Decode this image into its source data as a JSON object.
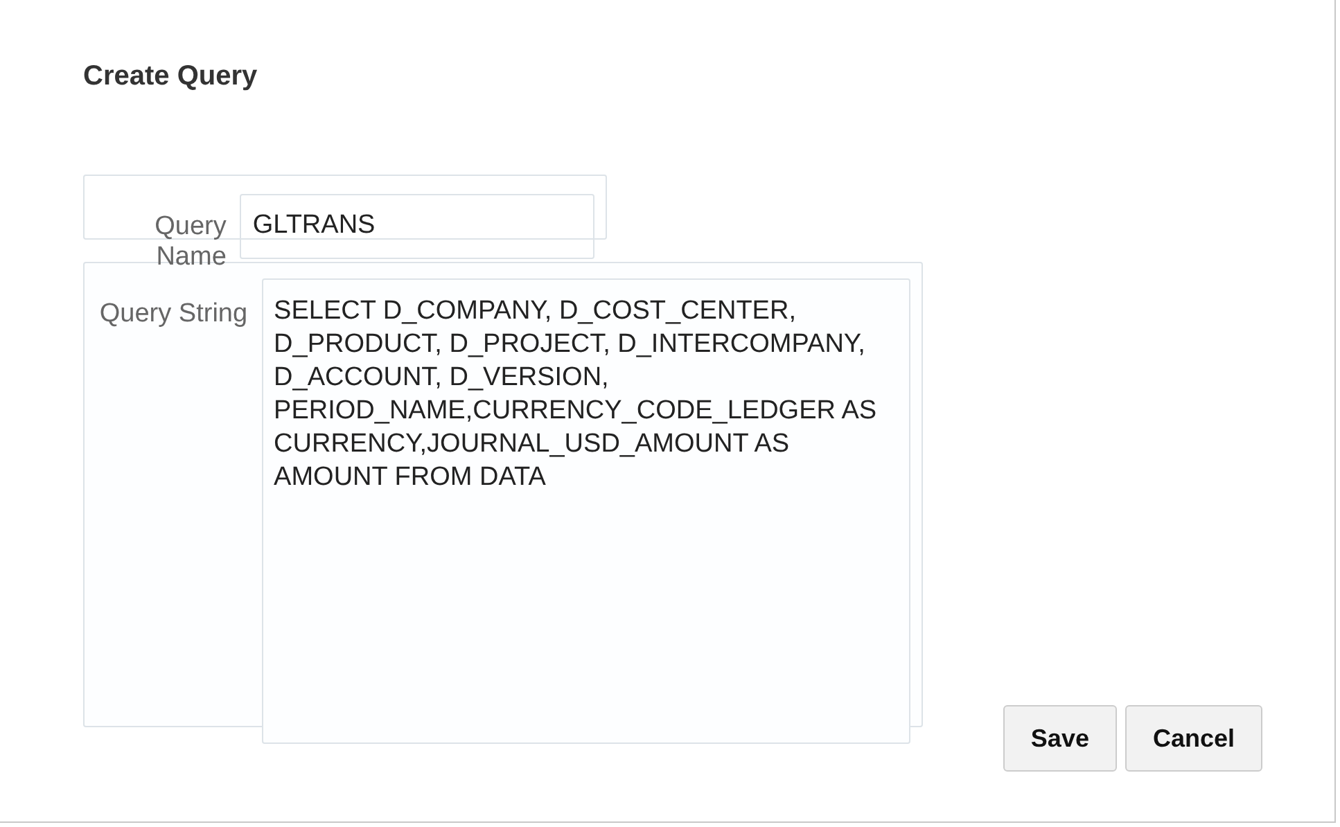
{
  "dialog": {
    "title": "Create Query"
  },
  "fields": [
    {
      "label": "Query Name",
      "value": "GLTRANS",
      "kind": "input"
    },
    {
      "label": "Query String",
      "value": "SELECT D_COMPANY, D_COST_CENTER, D_PRODUCT, D_PROJECT, D_INTERCOMPANY, D_ACCOUNT, D_VERSION, PERIOD_NAME,CURRENCY_CODE_LEDGER AS CURRENCY,JOURNAL_USD_AMOUNT AS AMOUNT FROM DATA",
      "kind": "textarea"
    }
  ],
  "buttons": [
    "Save",
    "Cancel"
  ]
}
